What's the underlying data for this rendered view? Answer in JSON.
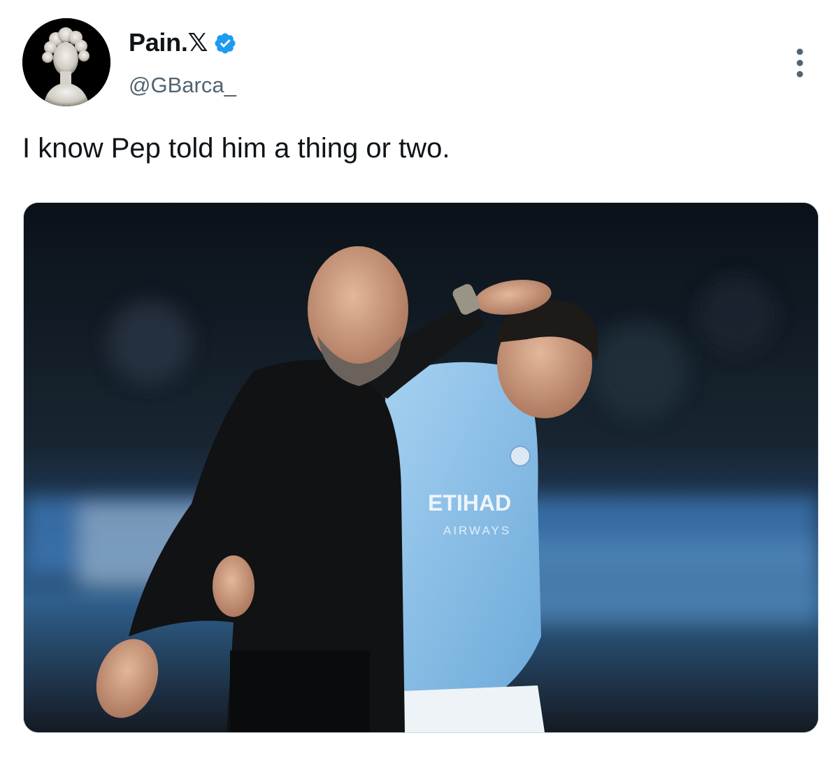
{
  "author": {
    "display_name": "Pain.𝕏",
    "handle": "@GBarca_",
    "avatar_icon": "marble-bust-avatar",
    "verified": true,
    "verified_color": "#1d9bf0"
  },
  "menu": {
    "icon": "more-vertical-icon"
  },
  "tweet": {
    "text": "I know Pep told him a thing or two."
  },
  "media": {
    "kind": "photo",
    "jersey_sponsor_line1": "ETIHAD",
    "jersey_sponsor_line2": "AIRWAYS"
  },
  "colors": {
    "text_primary": "#0f1419",
    "text_secondary": "#536471",
    "sky_blue_jersey": "#8fc3ea"
  }
}
